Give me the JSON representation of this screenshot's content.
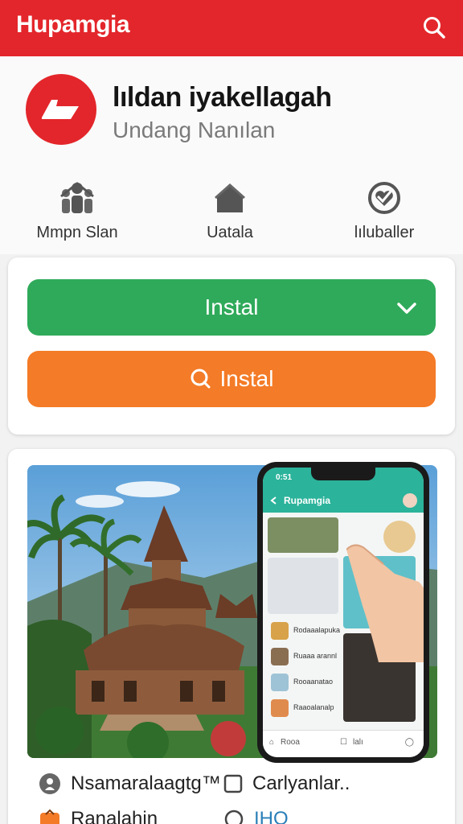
{
  "header": {
    "brand": "Hupamgia",
    "bg_color": "#e3262b",
    "search_icon": "search-icon"
  },
  "app": {
    "title": "lıldan iyakellagah",
    "subtitle": "Undang Nanılan",
    "logo_color": "#e3262b",
    "logo_icon": "folder-icon"
  },
  "features": [
    {
      "icon": "people-icon",
      "label": "Mmpn Slan"
    },
    {
      "icon": "home-icon",
      "label": "Uatala"
    },
    {
      "icon": "heart-badge-icon",
      "label": "lıluballer"
    }
  ],
  "install": {
    "primary_label": "Instal",
    "primary_color": "#2faa5a",
    "secondary_label": "Instal",
    "secondary_color": "#f47b27"
  },
  "preview": {
    "phone": {
      "status_time": "0:51",
      "app_title": "Rupamgia",
      "list": [
        {
          "text": "Rodaaalapuka"
        },
        {
          "text": "Ruaaa arannl"
        },
        {
          "text": "Rooaanatao"
        },
        {
          "text": "Raaoalanalp"
        }
      ],
      "nav": [
        "Rooa",
        "lalı"
      ]
    }
  },
  "meta": [
    {
      "icon": "location-icon",
      "text": "Nsamaralaagtg™"
    },
    {
      "icon": "checkbox-icon",
      "text": "Carlyanlar.."
    },
    {
      "icon": "bag-icon",
      "text": "Ranalahin"
    },
    {
      "icon": "circle-icon",
      "text": "IHO"
    }
  ]
}
